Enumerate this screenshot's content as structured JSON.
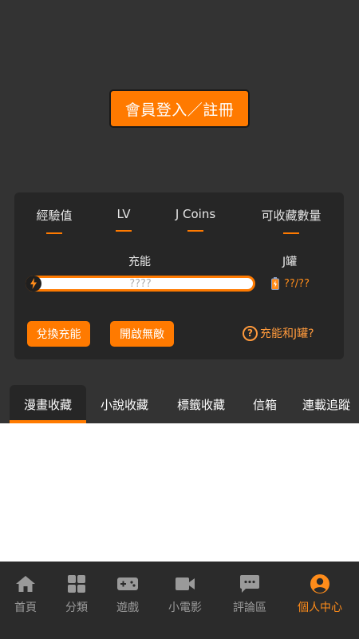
{
  "login": {
    "label": "會員登入／註冊"
  },
  "stats": [
    {
      "label": "經驗值",
      "value": ""
    },
    {
      "label": "LV",
      "value": ""
    },
    {
      "label": "J Coins",
      "value": ""
    },
    {
      "label": "可收藏數量",
      "value": ""
    }
  ],
  "energy": {
    "label": "充能",
    "value": "????"
  },
  "jar": {
    "label": "J罐",
    "value": "??/??"
  },
  "actions": {
    "exchange": "兌換充能",
    "invincible": "開啟無敵",
    "help": "充能和J罐?"
  },
  "tabs": [
    "漫畫收藏",
    "小說收藏",
    "標籤收藏",
    "信箱",
    "連載追蹤"
  ],
  "active_tab": "漫畫收藏",
  "nav": [
    {
      "label": "首頁",
      "icon": "home-icon"
    },
    {
      "label": "分類",
      "icon": "grid-icon"
    },
    {
      "label": "遊戲",
      "icon": "gamepad-icon"
    },
    {
      "label": "小電影",
      "icon": "video-camera-icon"
    },
    {
      "label": "評論區",
      "icon": "comment-icon"
    },
    {
      "label": "個人中心",
      "icon": "user-profile-icon"
    }
  ],
  "active_nav": "個人中心",
  "colors": {
    "accent": "#ff7a00",
    "background": "#333333",
    "card": "#262626",
    "nav_bg": "#2b2b2b",
    "nav_inactive": "#9a9a9a"
  }
}
